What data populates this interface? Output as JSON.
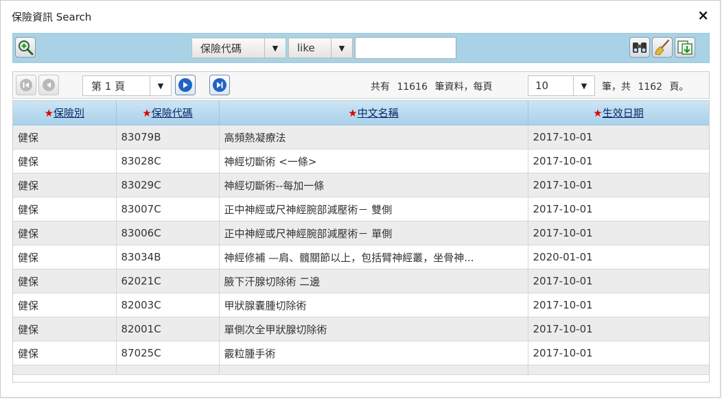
{
  "dialog": {
    "title": "保險資訊 Search",
    "close_label": "×"
  },
  "toolbar": {
    "field_select": "保險代碼",
    "operator_select": "like",
    "search_value": ""
  },
  "pager": {
    "page_select": "第 1 頁",
    "total_prefix": "共有",
    "total_records": "11616",
    "total_mid": "筆資料，每頁",
    "page_size": "10",
    "pages_prefix": "筆，共",
    "total_pages": "1162",
    "pages_suffix": "頁。"
  },
  "table": {
    "columns": [
      {
        "star": "★",
        "label": "保險別"
      },
      {
        "star": "★",
        "label": "保險代碼"
      },
      {
        "star": "★",
        "label": "中文名稱"
      },
      {
        "star": "★",
        "label": "生效日期"
      }
    ],
    "rows": [
      [
        "健保",
        "83079B",
        "高頻熱凝療法",
        "2017-10-01"
      ],
      [
        "健保",
        "83028C",
        "神經切斷術 <一條>",
        "2017-10-01"
      ],
      [
        "健保",
        "83029C",
        "神經切斷術--每加一條",
        "2017-10-01"
      ],
      [
        "健保",
        "83007C",
        "正中神經或尺神經腕部減壓術－ 雙側",
        "2017-10-01"
      ],
      [
        "健保",
        "83006C",
        "正中神經或尺神經腕部減壓術－ 單側",
        "2017-10-01"
      ],
      [
        "健保",
        "83034B",
        "神經修補 —肩、髖關節以上，包括臂神經叢，坐骨神...",
        "2020-01-01"
      ],
      [
        "健保",
        "62021C",
        "腋下汗腺切除術 二邊",
        "2017-10-01"
      ],
      [
        "健保",
        "82003C",
        "甲狀腺囊腫切除術",
        "2017-10-01"
      ],
      [
        "健保",
        "82001C",
        "單側次全甲狀腺切除術",
        "2017-10-01"
      ],
      [
        "健保",
        "87025C",
        "霰粒腫手術",
        "2017-10-01"
      ]
    ]
  },
  "icons": {
    "add_search": "magnifier-plus-icon",
    "find": "binoculars-icon",
    "clear": "broom-icon",
    "export": "export-icon"
  }
}
